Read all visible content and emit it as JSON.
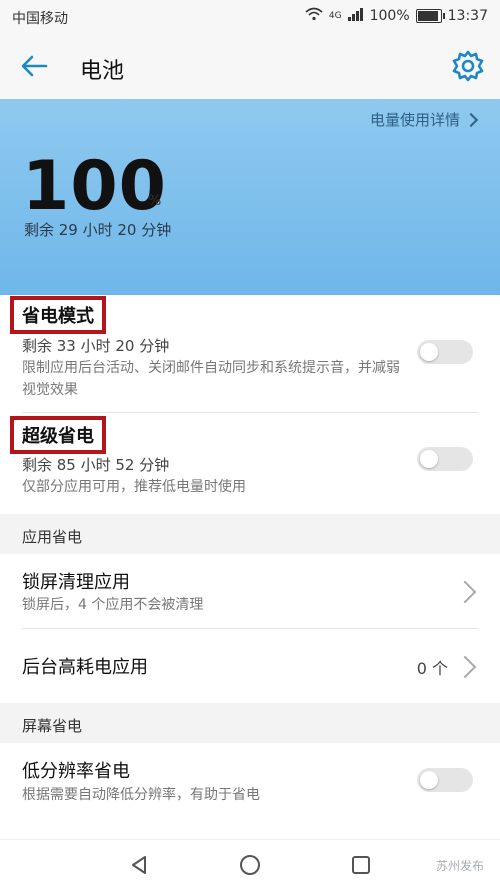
{
  "status": {
    "carrier": "中国移动",
    "network": "4G",
    "battery_percent": "100%",
    "time": "13:37"
  },
  "header": {
    "title": "电池"
  },
  "hero": {
    "details_link": "电量使用详情",
    "percent_value": "100",
    "percent_sign": "%",
    "remaining": "剩余 29 小时 20 分钟"
  },
  "power_saving": {
    "label": "省电模式",
    "remaining": "剩余 33 小时 20 分钟",
    "description": "限制应用后台活动、关闭邮件自动同步和系统提示音，并减弱视觉效果"
  },
  "ultra_saving": {
    "label": "超级省电",
    "remaining": "剩余 85 小时 52 分钟",
    "description": "仅部分应用可用，推荐低电量时使用"
  },
  "app_section": {
    "title": "应用省电",
    "lock_cleanup": {
      "label": "锁屏清理应用",
      "description": "锁屏后，4 个应用不会被清理"
    },
    "background_heavy": {
      "label": "后台高耗电应用",
      "count": "0 个"
    }
  },
  "screen_section": {
    "title": "屏幕省电",
    "low_res": {
      "label": "低分辨率省电",
      "description": "根据需要自动降低分辨率，有助于省电"
    }
  },
  "watermark": "苏州发布",
  "colors": {
    "accent": "#1e88c7",
    "hero_bg": "#7fc1ee",
    "highlight_border": "#b3151b"
  }
}
